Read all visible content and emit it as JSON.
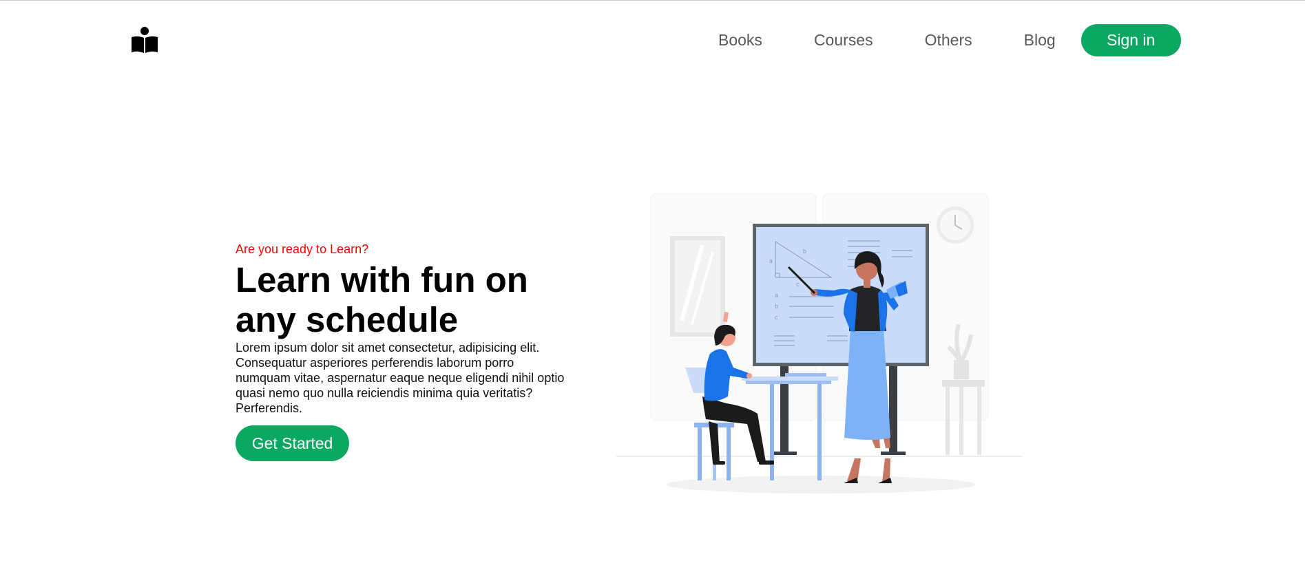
{
  "header": {
    "logo_icon": "book-reader-icon",
    "nav": {
      "books": "Books",
      "courses": "Courses",
      "others": "Others",
      "blog": "Blog"
    },
    "signin_label": "Sign in"
  },
  "hero": {
    "eyebrow": "Are you ready to Learn?",
    "headline": "Learn with fun on any schedule",
    "lead": "Lorem ipsum dolor sit amet consectetur, adipisicing elit. Consequatur asperiores perferendis laborum porro numquam vitae, aspernatur eaque neque eligendi nihil optio quasi nemo quo nulla reiciendis minima quia veritatis? Perferendis.",
    "cta_label": "Get Started",
    "illustration": {
      "icon": "teacher-classroom-illustration",
      "whiteboard_labels": [
        "a",
        "b",
        "c",
        "a",
        "b",
        "c"
      ]
    }
  },
  "colors": {
    "accent": "#0aa862",
    "eyebrow": "#ff0000",
    "nav_text": "#55595c",
    "illustration_blue": "#1a73e8",
    "illustration_light_blue": "#c9dcfb"
  }
}
